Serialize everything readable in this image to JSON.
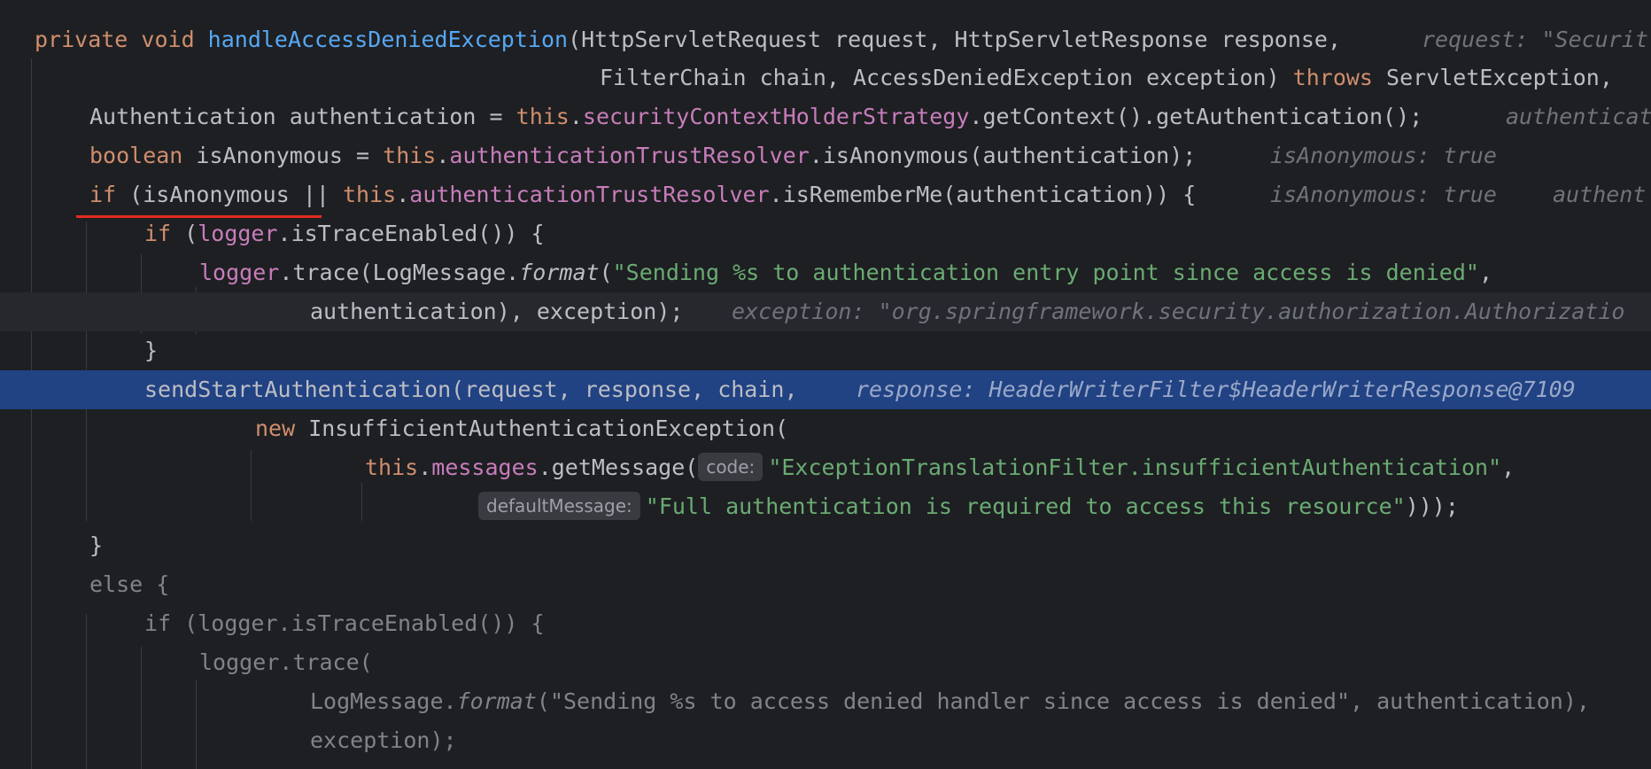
{
  "editor": {
    "lines": {
      "l1": {
        "t1": "private void ",
        "t2": "handleAccessDeniedException",
        "t3": "(HttpServletRequest request, HttpServletResponse response,",
        "hint": "request: \"Securit"
      },
      "l2": {
        "t1": "FilterChain chain, AccessDeniedException exception) ",
        "t2": "throws",
        "t3": " ServletException,"
      },
      "l3": {
        "t1": "Authentication authentication = ",
        "t2": "this",
        "t3": ".",
        "t4": "securityContextHolderStrategy",
        "t5": ".getContext().getAuthentication();",
        "hint": "authenticat"
      },
      "l4": {
        "t1": "boolean",
        "t2": " isAnonymous = ",
        "t3": "this",
        "t4": ".",
        "t5": "authenticationTrustResolver",
        "t6": ".isAnonymous(authentication);",
        "hint": "isAnonymous: true"
      },
      "l5": {
        "t1": "if",
        "t2": " (isAnonymous || ",
        "t3": "this",
        "t4": ".",
        "t5": "authenticationTrustResolver",
        "t6": ".isRememberMe(authentication)) {",
        "hint1": "isAnonymous: true",
        "hint2": "authent"
      },
      "l6": {
        "t1": "if",
        "t2": " (",
        "t3": "logger",
        "t4": ".isTraceEnabled()) {"
      },
      "l7": {
        "t1": "logger",
        "t2": ".trace(LogMessage.",
        "t3": "format",
        "t4": "(",
        "t5": "\"Sending %s to authentication entry point since access is denied\"",
        "t6": ","
      },
      "l8": {
        "t1": "authentication), exception);",
        "hint": "exception: \"org.springframework.security.authorization.Authorizatio"
      },
      "l9": {
        "t1": "}"
      },
      "l10": {
        "t1": "sendStartAuthentication(request, response, chain,",
        "hint": "response: HeaderWriterFilter$HeaderWriterResponse@7109"
      },
      "l11": {
        "t1": "new",
        "t2": " InsufficientAuthenticationException("
      },
      "l12": {
        "t1": "this",
        "t2": ".",
        "t3": "messages",
        "t4": ".getMessage(",
        "chip": "code:",
        "t5": "\"ExceptionTranslationFilter.insufficientAuthentication\"",
        "t6": ","
      },
      "l13": {
        "chip": "defaultMessage:",
        "t1": "\"Full authentication is required to access this resource\"",
        "t2": ")));"
      },
      "l14": {
        "t1": "}"
      },
      "l15": {
        "t1": "else",
        "t2": " {"
      },
      "l16": {
        "t1": "if",
        "t2": " (logger.isTraceEnabled()) {"
      },
      "l17": {
        "t1": "logger.trace("
      },
      "l18": {
        "t1": "LogMessage.",
        "t2": "format",
        "t3": "(",
        "t4": "\"Sending %s to access denied handler since access is denied\"",
        "t5": ", authentication),"
      },
      "l19": {
        "t1": "exception);"
      }
    },
    "colors": {
      "background": "#1e1f22",
      "execution_line": "#214283",
      "keyword": "#cf8e6d",
      "method_declaration": "#56a8f5",
      "field": "#c77dbb",
      "string": "#6aab73",
      "inline_hint": "#6f737a",
      "underline_marker": "#e32b20"
    }
  }
}
